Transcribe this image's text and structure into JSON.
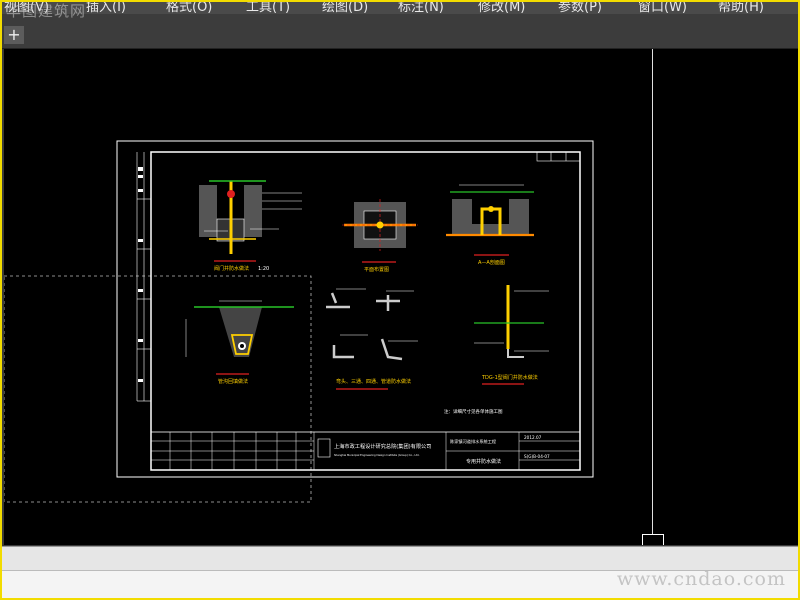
{
  "app": {
    "menus": [
      "视图(V)",
      "插入(I)",
      "格式(O)",
      "工具(T)",
      "绘图(D)",
      "标注(N)",
      "修改(M)",
      "参数(P)",
      "窗口(W)",
      "帮助(H)"
    ],
    "watermark_top": "华图建筑网",
    "tab_add_icon": "+",
    "footer_watermark": "www.cndao.com"
  },
  "drawing": {
    "company": "上海市政工程设计研究总院(集团)有限公司",
    "company_en": "Shanghai Municipal Engineering Design Institute (Group) Co., Ltd.",
    "project": "陈家镇河道排水系统工程",
    "sheet_title": "专用井防水做法",
    "drawing_no": "S(G)B-04-07",
    "date": "2012.07",
    "scale_label": "1:20",
    "captions": [
      "阀门井防水做法",
      "平面布置图",
      "A—A剖面图",
      "管沟回填做法",
      "弯头、三通、四通、管道防水做法",
      "TDG-1型阀门井防水做法"
    ],
    "note": "注：详细尺寸见各单体施工图"
  },
  "colors": {
    "frame": "#f2dc00",
    "canvas": "#000000",
    "line": "#ffffff",
    "yellow": "#ffd000",
    "red": "#e02020",
    "orange": "#ff8a00",
    "green": "#28c428",
    "cyan": "#20c8d8"
  }
}
